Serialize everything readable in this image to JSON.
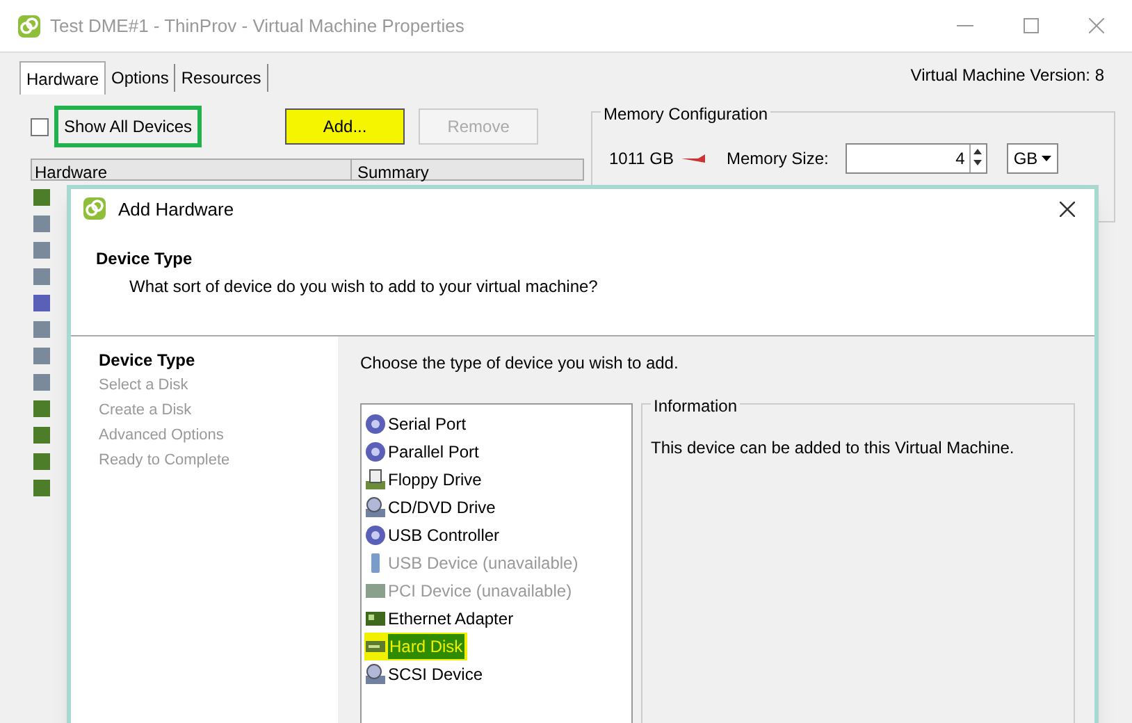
{
  "window": {
    "title": "Test DME#1 - ThinProv - Virtual Machine Properties",
    "version": "Virtual Machine Version: 8"
  },
  "tabs": [
    {
      "label": "Hardware",
      "selected": true
    },
    {
      "label": "Options",
      "selected": false
    },
    {
      "label": "Resources",
      "selected": false
    }
  ],
  "show_all_devices": {
    "label": "Show All Devices",
    "checked": false,
    "outlined": true
  },
  "buttons": [
    {
      "label": "Add...",
      "disabled": false,
      "highlighted": true
    },
    {
      "label": "Remove",
      "disabled": true,
      "highlighted": false
    }
  ],
  "table": {
    "columns": [
      "Hardware",
      "Summary"
    ]
  },
  "memory": {
    "group": "Memory Configuration",
    "scale_label": "1011 GB",
    "size_label": "Memory Size:",
    "size_value": "4",
    "unit": "GB"
  },
  "dialog": {
    "title": "Add Hardware",
    "heading": "Device Type",
    "subheading": "What sort of device do you wish to add to your virtual machine?",
    "steps": [
      {
        "label": "Device Type",
        "selected": true
      },
      {
        "label": "Select a Disk",
        "selected": false
      },
      {
        "label": "Create a Disk",
        "selected": false
      },
      {
        "label": "Advanced Options",
        "selected": false
      },
      {
        "label": "Ready to Complete",
        "selected": false
      }
    ],
    "prompt": "Choose the type of device you wish to add.",
    "devices": [
      {
        "label": "Serial Port",
        "kind": "port",
        "disabled": false,
        "selected": false
      },
      {
        "label": "Parallel Port",
        "kind": "port",
        "disabled": false,
        "selected": false
      },
      {
        "label": "Floppy Drive",
        "kind": "floppy",
        "disabled": false,
        "selected": false
      },
      {
        "label": "CD/DVD Drive",
        "kind": "cd",
        "disabled": false,
        "selected": false
      },
      {
        "label": "USB Controller",
        "kind": "port",
        "disabled": false,
        "selected": false
      },
      {
        "label": "USB Device (unavailable)",
        "kind": "usb",
        "disabled": true,
        "selected": false
      },
      {
        "label": "PCI Device (unavailable)",
        "kind": "pci",
        "disabled": true,
        "selected": false
      },
      {
        "label": "Ethernet Adapter",
        "kind": "nic",
        "disabled": false,
        "selected": false
      },
      {
        "label": "Hard Disk",
        "kind": "disk",
        "disabled": false,
        "selected": true
      },
      {
        "label": "SCSI Device",
        "kind": "cd",
        "disabled": false,
        "selected": false
      }
    ],
    "info": {
      "title": "Information",
      "text": "This device can be added to this Virtual Machine."
    }
  }
}
